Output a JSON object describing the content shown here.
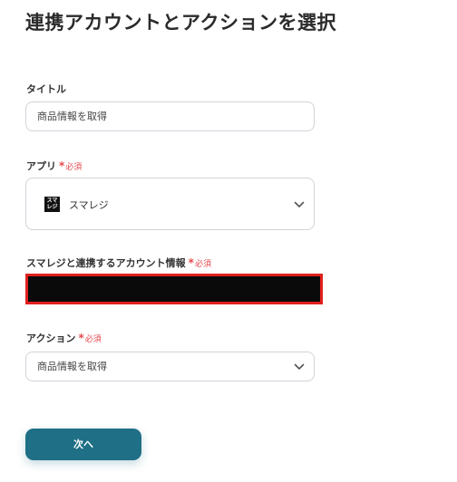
{
  "page": {
    "title": "連携アカウントとアクションを選択"
  },
  "fields": {
    "title_field": {
      "label": "タイトル",
      "value": "商品情報を取得"
    },
    "app_field": {
      "label": "アプリ",
      "required_star": "*",
      "required_text": "必須",
      "value": "スマレジ",
      "logo_text": "スマレジ",
      "logo_icon": "smaregi-logo-icon"
    },
    "account_field": {
      "label": "スマレジと連携するアカウント情報",
      "required_star": "*",
      "required_text": "必須"
    },
    "action_field": {
      "label": "アクション",
      "required_star": "*",
      "required_text": "必須",
      "value": "商品情報を取得"
    }
  },
  "buttons": {
    "next_label": "次へ"
  },
  "colors": {
    "accent": "#1f6f86",
    "required": "#e5484d",
    "redaction_border": "#e0201e",
    "redaction_fill": "#0a0a0a"
  },
  "icons": {
    "dropdown": "chevron-down-icon"
  }
}
